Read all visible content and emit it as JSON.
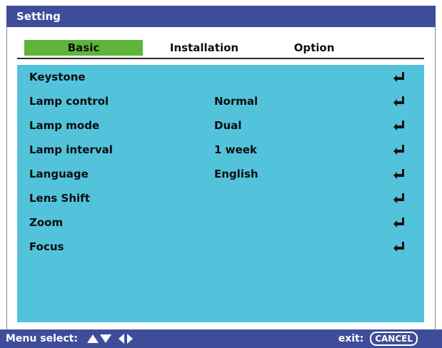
{
  "window": {
    "title": "Setting"
  },
  "tabs": [
    {
      "label": "Basic",
      "active": true
    },
    {
      "label": "Installation",
      "active": false
    },
    {
      "label": "Option",
      "active": false
    }
  ],
  "menu": {
    "items": [
      {
        "label": "Keystone",
        "value": "",
        "action_icon": "enter-icon"
      },
      {
        "label": "Lamp control",
        "value": "Normal",
        "action_icon": "enter-icon"
      },
      {
        "label": "Lamp mode",
        "value": "Dual",
        "action_icon": "enter-icon"
      },
      {
        "label": "Lamp interval",
        "value": "1 week",
        "action_icon": "enter-icon"
      },
      {
        "label": "Language",
        "value": "English",
        "action_icon": "enter-icon"
      },
      {
        "label": "Lens Shift",
        "value": "",
        "action_icon": "enter-icon"
      },
      {
        "label": "Zoom",
        "value": "",
        "action_icon": "enter-icon"
      },
      {
        "label": "Focus",
        "value": "",
        "action_icon": "enter-icon"
      }
    ]
  },
  "status": {
    "menu_select_label": "Menu select:",
    "nav_icons": [
      "up-arrow-icon",
      "down-arrow-icon",
      "left-arrow-icon",
      "right-arrow-icon"
    ],
    "exit_label": "exit:",
    "cancel_key": "CANCEL"
  },
  "colors": {
    "title_bar": "#3d4d99",
    "active_tab": "#5fb43a",
    "content_bg": "#52c3da",
    "status_bar": "#3d4d99"
  }
}
